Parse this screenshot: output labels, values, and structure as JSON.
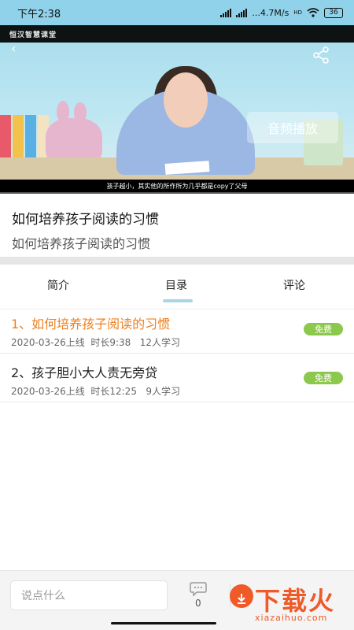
{
  "status_bar": {
    "time": "下午2:38",
    "network_speed": "...4.7M/s",
    "network_type": "HD",
    "battery": "36"
  },
  "video": {
    "brand": "恒汉智慧课堂",
    "audio_button": "音频播放",
    "subtitle": "孩子越小，其实他的所作所为几乎都是copy了父母",
    "progress_fraction": 0.0
  },
  "lesson": {
    "title": "如何培养孩子阅读的习惯",
    "subtitle": "如何培养孩子阅读的习惯"
  },
  "tabs": [
    {
      "label": "简介"
    },
    {
      "label": "目录"
    },
    {
      "label": "评论"
    }
  ],
  "active_tab": "目录",
  "catalog": [
    {
      "title": "1、如何培养孩子阅读的习惯",
      "meta": "2020-03-26上线  时长9:38   12人学习",
      "badge": "免费",
      "active": true
    },
    {
      "title": "2、孩子胆小大人责无旁贷",
      "meta": "2020-03-26上线  时长12:25   9人学习",
      "badge": "免费",
      "active": false
    }
  ],
  "comment_bar": {
    "placeholder": "说点什么",
    "comment_count": "0"
  },
  "watermark": {
    "text": "下载火",
    "url": "xiazaihuo.com"
  },
  "colors": {
    "status_bar": "#8fd2ea",
    "active_item": "#ee7f1e",
    "badge": "#8cc84b",
    "tab_indicator": "#a9d6e5",
    "watermark": "#ef5a28"
  }
}
